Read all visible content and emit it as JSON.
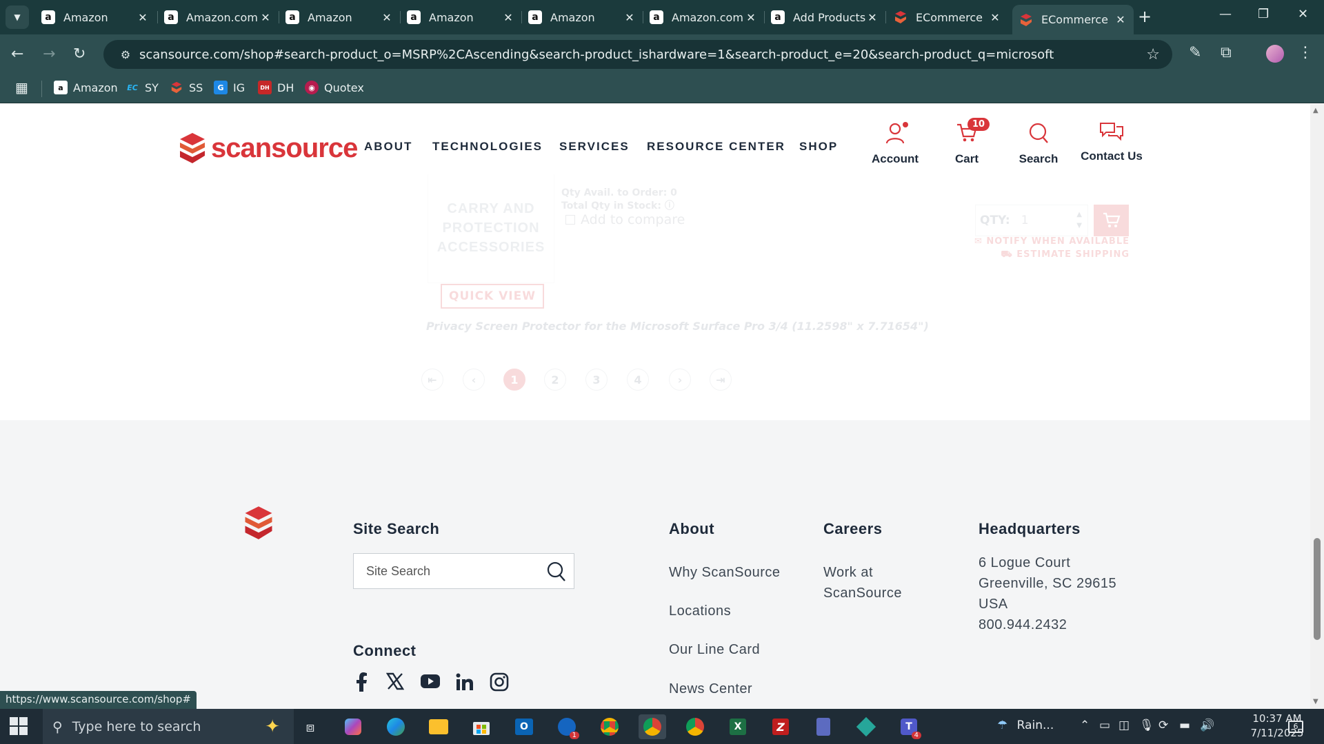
{
  "browser": {
    "tabs": [
      {
        "title": "Amazon",
        "favicon": "amazon-icon"
      },
      {
        "title": "Amazon.com",
        "favicon": "amazon-icon"
      },
      {
        "title": "Amazon",
        "favicon": "amazon-icon"
      },
      {
        "title": "Amazon",
        "favicon": "amazon-icon"
      },
      {
        "title": "Amazon",
        "favicon": "amazon-icon"
      },
      {
        "title": "Amazon.com",
        "favicon": "amazon-icon"
      },
      {
        "title": "Add Products",
        "favicon": "amazon-icon"
      },
      {
        "title": "ECommerce",
        "favicon": "scansource-icon"
      },
      {
        "title": "ECommerce",
        "favicon": "scansource-icon",
        "active": true
      }
    ],
    "url": "scansource.com/shop#search-product_o=MSRP%2CAscending&search-product_ishardware=1&search-product_e=20&search-product_q=microsoft",
    "bookmarks": [
      {
        "label": "Amazon"
      },
      {
        "label": "SY"
      },
      {
        "label": "SS"
      },
      {
        "label": "IG"
      },
      {
        "label": "DH"
      },
      {
        "label": "Quotex"
      }
    ],
    "status_url": "https://www.scansource.com/shop#"
  },
  "site": {
    "logo_text": "scansource",
    "nav": [
      "ABOUT",
      "TECHNOLOGIES",
      "SERVICES",
      "RESOURCE CENTER",
      "SHOP"
    ],
    "account_label": "Account",
    "cart_label": "Cart",
    "cart_count": "10",
    "search_label": "Search",
    "contact_label": "Contact Us",
    "brand_color": "#d9353a"
  },
  "product": {
    "image_text": "CARRY AND PROTECTION ACCESSORIES",
    "qty_avail": "Qty Avail. to Order: 0",
    "total_qty": "Total Qty in Stock:",
    "compare_label": "Add to compare",
    "quick_view": "QUICK VIEW",
    "description": "Privacy Screen Protector for the Microsoft Surface Pro 3/4 (11.2598\" x 7.71654\")",
    "qty_label": "QTY:",
    "qty_value": "1",
    "notify": "NOTIFY WHEN AVAILABLE",
    "estimate": "ESTIMATE SHIPPING"
  },
  "pagination": {
    "pages": [
      "1",
      "2",
      "3",
      "4"
    ],
    "current": "1"
  },
  "footer": {
    "site_search_heading": "Site Search",
    "site_search_placeholder": "Site Search",
    "connect_heading": "Connect",
    "about_heading": "About",
    "about_links": [
      "Why ScanSource",
      "Locations",
      "Our Line Card",
      "News Center"
    ],
    "careers_heading": "Careers",
    "careers_link": "Work at ScanSource",
    "hq_heading": "Headquarters",
    "hq_lines": [
      "6 Logue Court",
      "Greenville, SC 29615",
      "USA",
      "800.944.2432"
    ]
  },
  "taskbar": {
    "search_placeholder": "Type here to search",
    "weather": "Rain...",
    "time": "10:37 AM",
    "date": "7/11/2025",
    "notifications": "6",
    "outlook_badge": "1",
    "teams_badge": "4"
  }
}
